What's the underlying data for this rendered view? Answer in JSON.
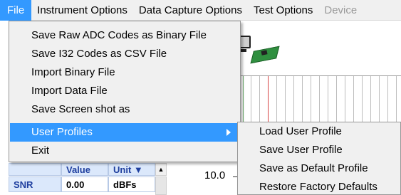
{
  "menubar": {
    "items": [
      {
        "label": "File",
        "state": "active"
      },
      {
        "label": "Instrument Options",
        "state": "normal"
      },
      {
        "label": "Data Capture Options",
        "state": "normal"
      },
      {
        "label": "Test Options",
        "state": "normal"
      },
      {
        "label": "Device",
        "state": "disabled"
      }
    ]
  },
  "file_menu": {
    "items": [
      {
        "label": "Save Raw ADC Codes as Binary File"
      },
      {
        "label": "Save I32 Codes as CSV File"
      },
      {
        "label": "Import Binary File"
      },
      {
        "label": "Import Data File"
      },
      {
        "label": "Save Screen shot as"
      },
      {
        "label": "User Profiles",
        "has_submenu": true,
        "highlighted": true
      },
      {
        "label": "Exit"
      }
    ]
  },
  "user_profiles_submenu": {
    "items": [
      {
        "label": "Load User Profile"
      },
      {
        "label": "Save User Profile"
      },
      {
        "label": "Save as Default Profile"
      },
      {
        "label": "Restore Factory Defaults"
      }
    ]
  },
  "results_table": {
    "headers": [
      "Value",
      "Unit ▼"
    ],
    "rows": [
      {
        "metric": "SNR",
        "value": "0.00",
        "unit": "dBFs"
      }
    ]
  },
  "plot": {
    "y_tick_label": "10.0"
  },
  "icons": {
    "scroll_up": "▲",
    "submenu_arrow": "triangle-right"
  },
  "colors": {
    "highlight": "#3399ff",
    "menubar_bg": "#f0f0f0",
    "table_header": "#1f3f9f",
    "table_header_bg": "#dbe8fb"
  }
}
